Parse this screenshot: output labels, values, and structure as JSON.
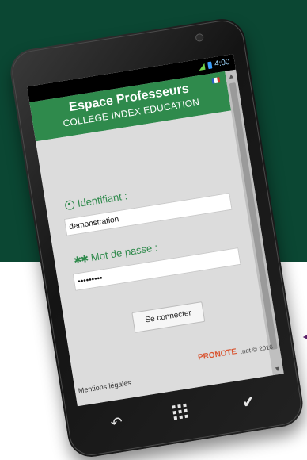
{
  "statusbar": {
    "time": "4:00"
  },
  "header": {
    "title": "Espace Professeurs",
    "subtitle": "COLLEGE INDEX EDUCATION"
  },
  "login": {
    "identifiant_label": "Identifiant :",
    "identifiant_value": "demonstration",
    "password_label": "Mot de passe :",
    "password_value": "•••••••••",
    "connect_button": "Se connecter"
  },
  "footer": {
    "brand": "PRONOTE",
    "copyright": ".net © 2016",
    "legal": "Mentions légales"
  },
  "colors": {
    "background_top": "#0b4733",
    "header_green": "#2f8a4c",
    "label_green": "#2f8a4c"
  },
  "icons": {
    "identifiant": "user-circle-icon",
    "password": "key-icon",
    "scroll_up": "chevron-up-icon",
    "scroll_down": "chevron-down-icon",
    "nav_back": "back-arrow-icon",
    "nav_apps": "grid-icon",
    "nav_check": "check-icon",
    "flag": "flag-icon"
  }
}
